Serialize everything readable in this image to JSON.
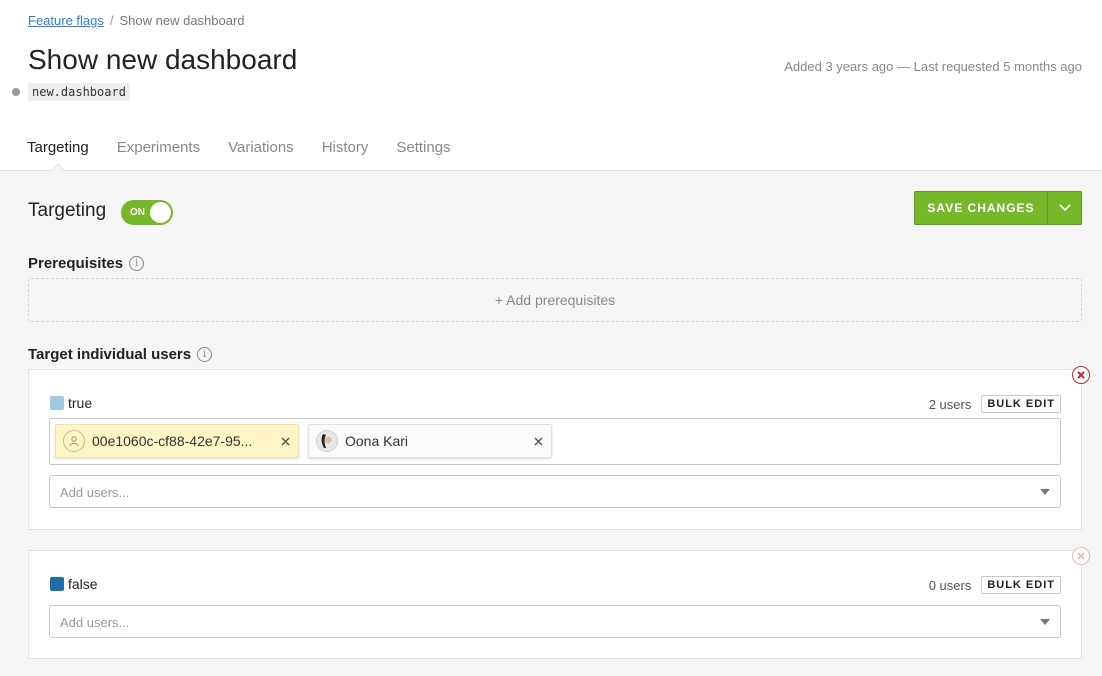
{
  "breadcrumb": {
    "parent": "Feature flags",
    "separator": "/",
    "current": "Show new dashboard"
  },
  "flag": {
    "name": "Show new dashboard",
    "key": "new.dashboard",
    "meta": "Added 3 years ago — Last requested 5 months ago"
  },
  "tabs": [
    {
      "label": "Targeting",
      "active": true
    },
    {
      "label": "Experiments",
      "active": false
    },
    {
      "label": "Variations",
      "active": false
    },
    {
      "label": "History",
      "active": false
    },
    {
      "label": "Settings",
      "active": false
    }
  ],
  "targeting": {
    "title": "Targeting",
    "toggle_label": "ON",
    "toggle_on": true
  },
  "save": {
    "label": "SAVE CHANGES"
  },
  "prerequisites": {
    "title": "Prerequisites",
    "add_label": "+ Add prerequisites"
  },
  "individual": {
    "title": "Target individual users",
    "variations": [
      {
        "name": "true",
        "color": "#9ecbe0",
        "count": "2 users",
        "bulk_label": "BULK EDIT",
        "users": [
          {
            "label": "00e1060c-cf88-42e7-95...",
            "kind": "anonymous",
            "style": "yellow"
          },
          {
            "label": "Oona Kari",
            "kind": "photo",
            "style": "white"
          }
        ],
        "placeholder": "Add users..."
      },
      {
        "name": "false",
        "color": "#1f6fa8",
        "count": "0 users",
        "bulk_label": "BULK EDIT",
        "users": [],
        "placeholder": "Add users..."
      }
    ]
  },
  "colors": {
    "accent_green": "#76b82a",
    "link_blue": "#2d7cd6",
    "remove_red": "#c8262b"
  }
}
